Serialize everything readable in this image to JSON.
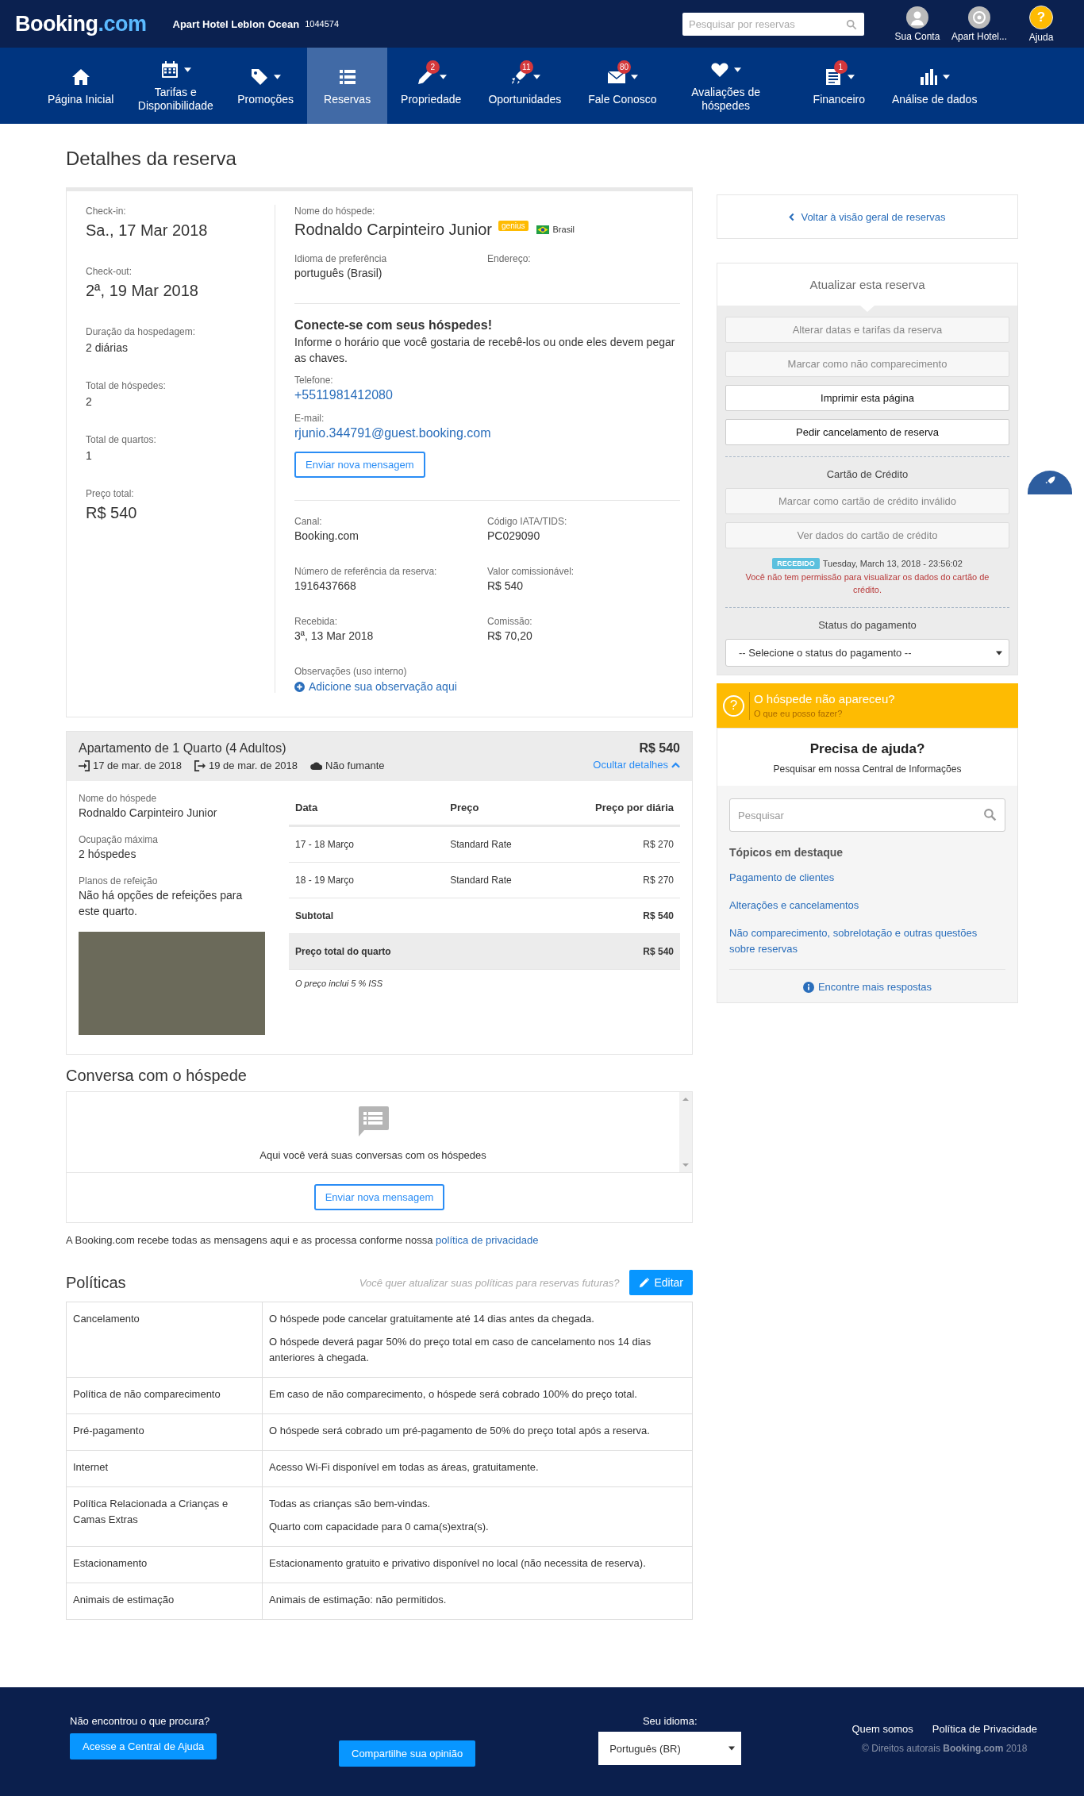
{
  "header": {
    "logo_main": "Booking",
    "logo_suffix": ".com",
    "hotel_name": "Apart Hotel Leblon Ocean",
    "hotel_id": "1044574",
    "search": {
      "placeholder": "Pesquisar por reservas"
    },
    "account_links": [
      {
        "label": "Sua Conta",
        "kind": "user"
      },
      {
        "label": "Apart Hotel...",
        "kind": "hotel"
      },
      {
        "label": "Ajuda",
        "kind": "help",
        "glyph": "?"
      }
    ]
  },
  "nav": [
    {
      "label": "Página Inicial",
      "kind": "home",
      "dropdown": false,
      "selected": false
    },
    {
      "label": "Tarifas e Disponibilidade",
      "kind": "calendar",
      "dropdown": true,
      "selected": false
    },
    {
      "label": "Promoções",
      "kind": "tag",
      "dropdown": true,
      "selected": false
    },
    {
      "label": "Reservas",
      "kind": "list",
      "dropdown": false,
      "selected": true
    },
    {
      "label": "Propriedade",
      "kind": "pencil",
      "badge": "2",
      "dropdown": true,
      "selected": false
    },
    {
      "label": "Oportunidades",
      "kind": "rocket",
      "badge": "11",
      "dropdown": true,
      "selected": false
    },
    {
      "label": "Fale Conosco",
      "kind": "envelope",
      "badge": "80",
      "dropdown": true,
      "selected": false
    },
    {
      "label": "Avaliações de hóspedes",
      "kind": "heart",
      "dropdown": true,
      "selected": false
    },
    {
      "label": "Financeiro",
      "kind": "document",
      "badge": "1",
      "dropdown": true,
      "selected": false
    },
    {
      "label": "Análise de dados",
      "kind": "chart",
      "dropdown": true,
      "selected": false
    }
  ],
  "page_title": "Detalhes da reserva",
  "stay": [
    {
      "label": "Check-in:",
      "value": "Sa., 17 Mar 2018",
      "kind": "large"
    },
    {
      "label": "Check-out:",
      "value": "2ª, 19 Mar 2018",
      "kind": "large"
    },
    {
      "label": "Duração da hospedagem:",
      "value": "2 diárias",
      "kind": "plain"
    },
    {
      "label": "Total de hóspedes:",
      "value": "2",
      "kind": "plain"
    },
    {
      "label": "Total de quartos:",
      "value": "1",
      "kind": "plain"
    },
    {
      "label": "Preço total:",
      "value": "R$ 540",
      "kind": "large"
    }
  ],
  "guest": {
    "label": "Nome do hóspede:",
    "name": "Rodnaldo Carpinteiro Junior",
    "badge": "genius",
    "country": "Brasil",
    "language_label": "Idioma de preferência",
    "language": "português (Brasil)",
    "address_label": "Endereço:"
  },
  "connect": {
    "title": "Conecte-se com seus hóspedes!",
    "text": "Informe o horário que você gostaria de recebê-los ou onde eles devem pegar as chaves.",
    "phone_label": "Telefone:",
    "phone": "+5511981412080",
    "email_label": "E-mail:",
    "email": "rjunio.344791@guest.booking.com",
    "button": "Enviar nova mensagem"
  },
  "booking_info": [
    {
      "label": "Canal:",
      "value": "Booking.com"
    },
    {
      "label": "Código IATA/TIDS:",
      "value": "PC029090"
    },
    {
      "label": "Número de referência da reserva:",
      "value": "1916437668"
    },
    {
      "label": "Valor comissionável:",
      "value": "R$ 540"
    },
    {
      "label": "Recebida:",
      "value": "3ª, 13 Mar 2018"
    },
    {
      "label": "Comissão:",
      "value": "R$ 70,20"
    }
  ],
  "notes": {
    "label": "Observações (uso interno)",
    "link": "Adicione sua observação aqui"
  },
  "room": {
    "title": "Apartamento de 1 Quarto (4 Adultos)",
    "price": "R$ 540",
    "checkin": "17 de mar. de 2018",
    "checkout": "19 de mar. de 2018",
    "smoking": "Não fumante",
    "toggle": "Ocultar detalhes",
    "expanded": true,
    "details": [
      {
        "label": "Nome do hóspede",
        "value": "Rodnaldo Carpinteiro Junior"
      },
      {
        "label": "Ocupação máxima",
        "value": "2 hóspedes"
      },
      {
        "label": "Planos de refeição",
        "value": "Não há opções de refeições para este quarto."
      }
    ],
    "table": {
      "columns": [
        "Data",
        "Preço",
        "Preço por diária"
      ],
      "rows": [
        {
          "cells": [
            "17 - 18 Março",
            "Standard Rate",
            "R$ 270"
          ]
        },
        {
          "cells": [
            "18 - 19 Março",
            "Standard Rate",
            "R$ 270"
          ]
        }
      ],
      "subtotal": {
        "label": "Subtotal",
        "value": "R$ 540"
      },
      "total": {
        "label": "Preço total do quarto",
        "value": "R$ 540"
      }
    },
    "note": "O preço inclui 5 % ISS"
  },
  "conversation": {
    "title": "Conversa com o hóspede",
    "empty_text": "Aqui você verá suas conversas com os hóspedes",
    "button": "Enviar nova mensagem"
  },
  "privacy": {
    "text": "A Booking.com recebe todas as mensagens aqui e as processa conforme nossa ",
    "link": "política de privacidade"
  },
  "policies": {
    "title": "Políticas",
    "prompt": "Você quer atualizar suas políticas para reservas futuras?",
    "edit_button": "Editar",
    "rows": [
      {
        "name": "Cancelamento",
        "lines": [
          "O hóspede pode cancelar gratuitamente até 14 dias antes da chegada.",
          "O hóspede deverá pagar 50% do preço total em caso de cancelamento nos 14 dias anteriores à chegada."
        ]
      },
      {
        "name": "Política de não comparecimento",
        "lines": [
          "Em caso de não comparecimento, o hóspede será cobrado 100% do preço total."
        ]
      },
      {
        "name": "Pré-pagamento",
        "lines": [
          "O hóspede será cobrado um pré-pagamento de 50% do preço total após a reserva."
        ]
      },
      {
        "name": "Internet",
        "lines": [
          "Acesso Wi-Fi disponível em todas as áreas, gratuitamente."
        ]
      },
      {
        "name": "Política Relacionada a Crianças e Camas Extras",
        "lines": [
          "Todas as crianças são bem-vindas.",
          "Quarto com capacidade para 0 cama(s)extra(s)."
        ]
      },
      {
        "name": "Estacionamento",
        "lines": [
          "Estacionamento gratuito e privativo disponível no local (não necessita de reserva)."
        ]
      },
      {
        "name": "Animais de estimação",
        "lines": [
          "Animais de estimação: não permitidos."
        ]
      }
    ]
  },
  "sidebar": {
    "back_link": "Voltar à visão geral de reservas",
    "update": {
      "title": "Atualizar esta reserva",
      "actions": [
        {
          "label": "Alterar datas e tarifas da reserva",
          "disabled": true
        },
        {
          "label": "Marcar como não comparecimento",
          "disabled": true
        },
        {
          "label": "Imprimir esta página",
          "disabled": false
        },
        {
          "label": "Pedir cancelamento de reserva",
          "disabled": false
        }
      ],
      "card_title": "Cartão de Crédito",
      "card_actions": [
        {
          "label": "Marcar como cartão de crédito inválido",
          "disabled": true
        },
        {
          "label": "Ver dados do cartão de crédito",
          "disabled": true
        }
      ],
      "status_badge": "RECEBIDO",
      "received_at": "Tuesday, March 13, 2018 - 23:56:02",
      "warning": "Você não tem permissão para visualizar os dados do cartão de crédito.",
      "payment_label": "Status do pagamento",
      "payment_select": "-- Selecione o status do pagamento --"
    },
    "no_show": {
      "icon_glyph": "?",
      "title": "O hóspede não apareceu?",
      "link": "O que eu posso fazer?"
    },
    "help": {
      "title": "Precisa de ajuda?",
      "subtitle": "Pesquisar em nossa Central de Informações",
      "search": {
        "placeholder": "Pesquisar"
      },
      "topics_title": "Tópicos em destaque",
      "topics": [
        "Pagamento de clientes",
        "Alterações e cancelamentos",
        "Não comparecimento, sobrelotação e outras questões sobre reservas"
      ],
      "more": "Encontre mais respostas"
    }
  },
  "footer": {
    "question": "Não encontrou o que procura?",
    "help_button": "Acesse a Central de Ajuda",
    "feedback_button": "Compartilhe sua opinião",
    "language_label": "Seu idioma:",
    "language": "Português (BR)",
    "links": [
      "Quem somos",
      "Política de Privacidade"
    ],
    "copyright": "© Direitos autorais **Booking.com** 2018"
  }
}
